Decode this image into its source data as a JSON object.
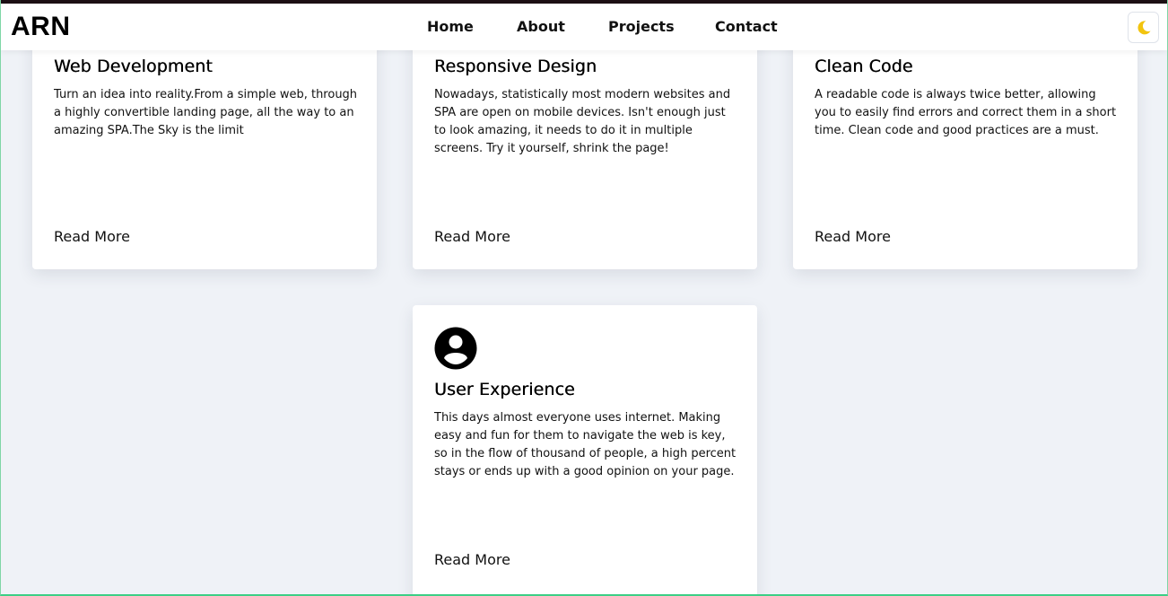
{
  "header": {
    "logo": "ARN",
    "nav": [
      {
        "label": "Home"
      },
      {
        "label": "About"
      },
      {
        "label": "Projects"
      },
      {
        "label": "Contact"
      }
    ],
    "theme_toggle_icon": "moon-icon",
    "theme_toggle_color": "#f2c40f"
  },
  "cards": [
    {
      "title": "Web Development",
      "text": "Turn an idea into reality.From a simple web, through a highly convertible landing page, all the way to an amazing SPA.The Sky is the limit",
      "link": "Read More"
    },
    {
      "title": "Responsive Design",
      "text": "Nowadays, statistically most modern websites and SPA are open on mobile devices. Isn't enough just to look amazing, it needs to do it in multiple screens. Try it yourself, shrink the page!",
      "link": "Read More"
    },
    {
      "title": "Clean Code",
      "text": "A readable code is always twice better, allowing you to easily find errors and correct them in a short time. Clean code and good practices are a must.",
      "link": "Read More"
    },
    {
      "title": "User Experience",
      "icon": "user-circle-icon",
      "text": "This days almost everyone uses internet. Making easy and fun for them to navigate the web is key, so in the flow of thousand of people, a high percent stays or ends up with a good opinion on your page.",
      "link": "Read More"
    }
  ]
}
